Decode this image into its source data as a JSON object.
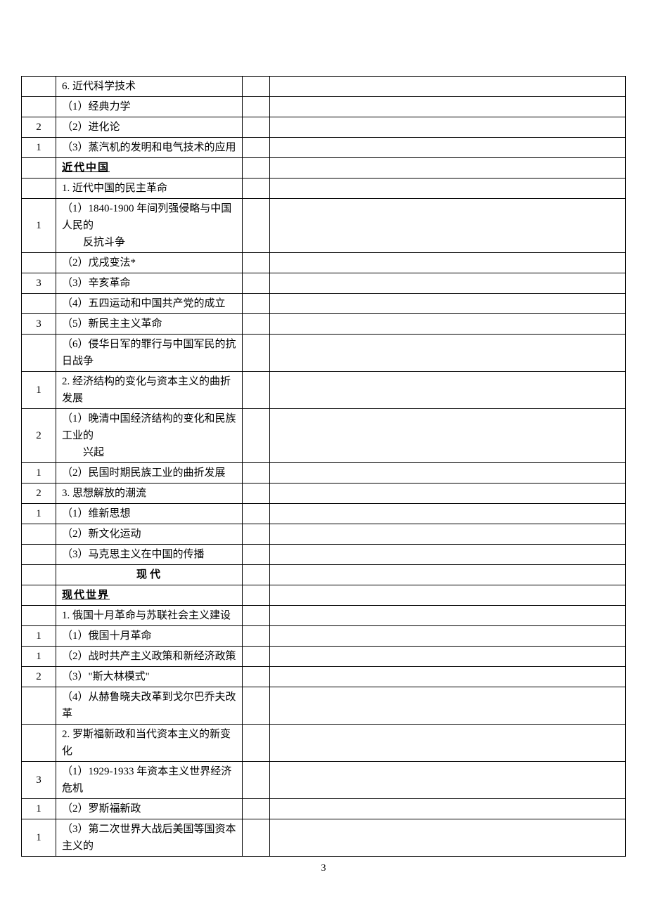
{
  "page_number": "3",
  "rows": [
    {
      "num": "",
      "text": "6. 近代科学技术",
      "type": "plain"
    },
    {
      "num": "",
      "text": "（1）经典力学",
      "type": "plain"
    },
    {
      "num": "2",
      "text": "（2）进化论",
      "type": "plain"
    },
    {
      "num": "1",
      "text": "（3）蒸汽机的发明和电气技术的应用",
      "type": "plain"
    },
    {
      "num": "",
      "text": "近代中国",
      "type": "heading"
    },
    {
      "num": "",
      "text": "1. 近代中国的民主革命",
      "type": "plain"
    },
    {
      "num": "1",
      "text": "（1）1840-1900 年间列强侵略与中国人民的",
      "text2": "反抗斗争",
      "type": "multi"
    },
    {
      "num": "",
      "text": "（2）戊戌变法*",
      "type": "plain"
    },
    {
      "num": "3",
      "text": "（3）辛亥革命",
      "type": "plain"
    },
    {
      "num": "",
      "text": "（4）五四运动和中国共产党的成立",
      "type": "plain"
    },
    {
      "num": "3",
      "text": "（5）新民主主义革命",
      "type": "plain"
    },
    {
      "num": "",
      "text": "（6）侵华日军的罪行与中国军民的抗日战争",
      "type": "plain"
    },
    {
      "num": "1",
      "text": "2. 经济结构的变化与资本主义的曲折发展",
      "type": "plain"
    },
    {
      "num": "2",
      "text": "（1）晚清中国经济结构的变化和民族工业的",
      "text2": "兴起",
      "type": "multi"
    },
    {
      "num": "1",
      "text": "（2）民国时期民族工业的曲折发展",
      "type": "plain"
    },
    {
      "num": "2",
      "text": "3. 思想解放的潮流",
      "type": "plain"
    },
    {
      "num": "1",
      "text": "（1）维新思想",
      "type": "plain"
    },
    {
      "num": "",
      "text": "（2）新文化运动",
      "type": "plain"
    },
    {
      "num": "",
      "text": "（3）马克思主义在中国的传播",
      "type": "plain"
    },
    {
      "num": "",
      "text": "现代",
      "type": "center"
    },
    {
      "num": "",
      "text": "现代世界",
      "type": "heading"
    },
    {
      "num": "",
      "text": "1. 俄国十月革命与苏联社会主义建设",
      "type": "plain"
    },
    {
      "num": "1",
      "text": "（1）俄国十月革命",
      "type": "plain"
    },
    {
      "num": "1",
      "text": "（2）战时共产主义政策和新经济政策",
      "type": "plain"
    },
    {
      "num": "2",
      "text": "（3）\"斯大林模式\"",
      "type": "plain"
    },
    {
      "num": "",
      "text": "（4）从赫鲁晓夫改革到戈尔巴乔夫改革",
      "type": "plain"
    },
    {
      "num": "",
      "text": "2. 罗斯福新政和当代资本主义的新变化",
      "type": "plain"
    },
    {
      "num": "3",
      "text": "（1）1929-1933 年资本主义世界经济危机",
      "type": "plain"
    },
    {
      "num": "1",
      "text": "（2）罗斯福新政",
      "type": "plain"
    },
    {
      "num": "1",
      "text": "（3）第二次世界大战后美国等国资本主义的",
      "type": "plain"
    }
  ]
}
